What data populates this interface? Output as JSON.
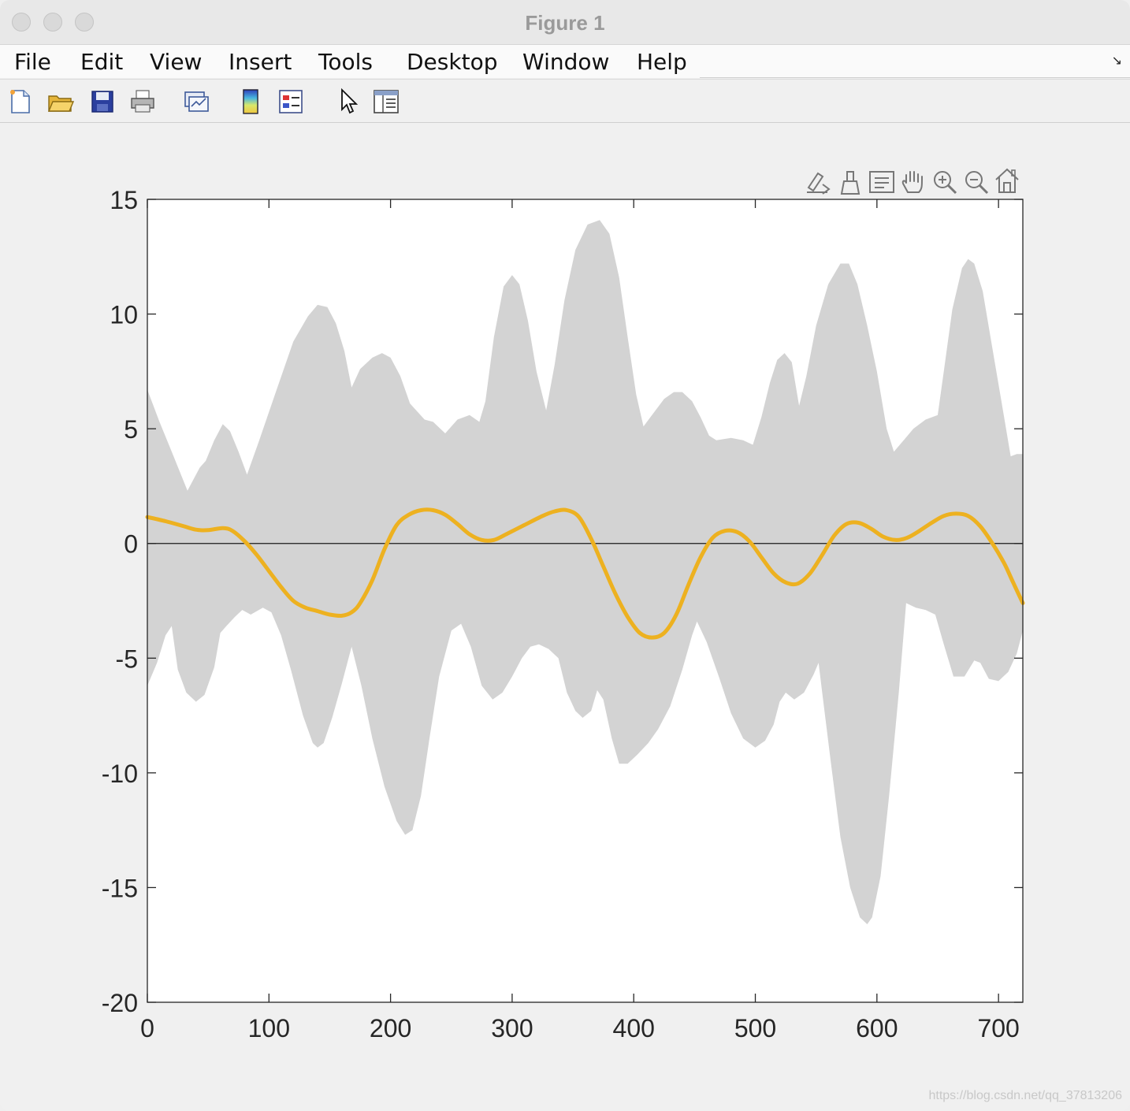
{
  "window": {
    "title": "Figure 1"
  },
  "menu": {
    "items": [
      "File",
      "Edit",
      "View",
      "Insert",
      "Tools",
      "Desktop",
      "Window",
      "Help"
    ]
  },
  "toolbar": {
    "icons": [
      "new-figure-icon",
      "open-file-icon",
      "save-icon",
      "print-icon",
      "link-plot-icon",
      "insert-colorbar-icon",
      "insert-legend-icon",
      "edit-plot-pointer-icon",
      "property-inspector-icon"
    ]
  },
  "axes_toolbar": {
    "icons": [
      "export-icon",
      "brush-icon",
      "data-tips-icon",
      "pan-hand-icon",
      "zoom-in-icon",
      "zoom-out-icon",
      "home-icon"
    ]
  },
  "watermark": "https://blog.csdn.net/qq_37813206",
  "colors": {
    "band": "#d3d3d3",
    "line": "#edb120",
    "zero_line": "#1a1a1a"
  },
  "chart_data": {
    "type": "area",
    "xlim": [
      0,
      720
    ],
    "ylim": [
      -20,
      15
    ],
    "x_ticks": [
      0,
      100,
      200,
      300,
      400,
      500,
      600,
      700
    ],
    "y_ticks": [
      15,
      10,
      5,
      0,
      -5,
      -10,
      -15,
      -20
    ],
    "grid": false,
    "legend": "none",
    "baseline": 0,
    "band_upper": [
      [
        0,
        6.7
      ],
      [
        10,
        5.3
      ],
      [
        20,
        4.0
      ],
      [
        33,
        2.3
      ],
      [
        43,
        3.3
      ],
      [
        48,
        3.6
      ],
      [
        55,
        4.5
      ],
      [
        62,
        5.2
      ],
      [
        68,
        4.9
      ],
      [
        75,
        4.0
      ],
      [
        82,
        3.0
      ],
      [
        92,
        4.5
      ],
      [
        105,
        6.5
      ],
      [
        120,
        8.8
      ],
      [
        132,
        9.9
      ],
      [
        140,
        10.4
      ],
      [
        148,
        10.3
      ],
      [
        155,
        9.6
      ],
      [
        162,
        8.4
      ],
      [
        168,
        6.8
      ],
      [
        175,
        7.6
      ],
      [
        185,
        8.1
      ],
      [
        193,
        8.3
      ],
      [
        200,
        8.1
      ],
      [
        208,
        7.3
      ],
      [
        216,
        6.1
      ],
      [
        228,
        5.4
      ],
      [
        235,
        5.3
      ],
      [
        245,
        4.8
      ],
      [
        255,
        5.4
      ],
      [
        265,
        5.6
      ],
      [
        273,
        5.3
      ],
      [
        278,
        6.2
      ],
      [
        285,
        9.0
      ],
      [
        293,
        11.2
      ],
      [
        300,
        11.7
      ],
      [
        306,
        11.3
      ],
      [
        313,
        9.7
      ],
      [
        320,
        7.5
      ],
      [
        328,
        5.8
      ],
      [
        335,
        7.8
      ],
      [
        343,
        10.6
      ],
      [
        352,
        12.8
      ],
      [
        362,
        13.9
      ],
      [
        372,
        14.1
      ],
      [
        380,
        13.5
      ],
      [
        388,
        11.6
      ],
      [
        395,
        9.0
      ],
      [
        402,
        6.5
      ],
      [
        408,
        5.1
      ],
      [
        415,
        5.6
      ],
      [
        425,
        6.3
      ],
      [
        433,
        6.6
      ],
      [
        440,
        6.6
      ],
      [
        448,
        6.2
      ],
      [
        455,
        5.5
      ],
      [
        462,
        4.7
      ],
      [
        468,
        4.5
      ],
      [
        480,
        4.6
      ],
      [
        490,
        4.5
      ],
      [
        498,
        4.3
      ],
      [
        505,
        5.5
      ],
      [
        512,
        7.0
      ],
      [
        518,
        8.0
      ],
      [
        524,
        8.3
      ],
      [
        530,
        7.9
      ],
      [
        536,
        6.0
      ],
      [
        542,
        7.3
      ],
      [
        550,
        9.5
      ],
      [
        560,
        11.3
      ],
      [
        570,
        12.2
      ],
      [
        577,
        12.2
      ],
      [
        584,
        11.3
      ],
      [
        592,
        9.5
      ],
      [
        600,
        7.5
      ],
      [
        608,
        5.0
      ],
      [
        614,
        4.0
      ],
      [
        622,
        4.5
      ],
      [
        630,
        5.0
      ],
      [
        640,
        5.4
      ],
      [
        650,
        5.6
      ],
      [
        655,
        7.5
      ],
      [
        662,
        10.2
      ],
      [
        670,
        12.0
      ],
      [
        675,
        12.4
      ],
      [
        680,
        12.2
      ],
      [
        687,
        11.0
      ],
      [
        695,
        8.5
      ],
      [
        703,
        6.0
      ],
      [
        710,
        3.8
      ],
      [
        715,
        3.9
      ],
      [
        720,
        3.9
      ]
    ],
    "band_lower": [
      [
        0,
        -6.2
      ],
      [
        8,
        -5.2
      ],
      [
        15,
        -4.0
      ],
      [
        20,
        -3.6
      ],
      [
        25,
        -5.5
      ],
      [
        32,
        -6.5
      ],
      [
        40,
        -6.9
      ],
      [
        47,
        -6.6
      ],
      [
        55,
        -5.4
      ],
      [
        60,
        -3.9
      ],
      [
        65,
        -3.6
      ],
      [
        72,
        -3.2
      ],
      [
        78,
        -2.9
      ],
      [
        85,
        -3.1
      ],
      [
        95,
        -2.8
      ],
      [
        102,
        -3.0
      ],
      [
        110,
        -4.0
      ],
      [
        118,
        -5.5
      ],
      [
        128,
        -7.5
      ],
      [
        136,
        -8.7
      ],
      [
        140,
        -8.9
      ],
      [
        145,
        -8.7
      ],
      [
        152,
        -7.6
      ],
      [
        160,
        -6.1
      ],
      [
        168,
        -4.5
      ],
      [
        176,
        -6.2
      ],
      [
        185,
        -8.5
      ],
      [
        195,
        -10.6
      ],
      [
        205,
        -12.1
      ],
      [
        212,
        -12.7
      ],
      [
        218,
        -12.5
      ],
      [
        225,
        -11.0
      ],
      [
        232,
        -8.5
      ],
      [
        240,
        -5.8
      ],
      [
        250,
        -3.8
      ],
      [
        258,
        -3.5
      ],
      [
        266,
        -4.5
      ],
      [
        275,
        -6.2
      ],
      [
        284,
        -6.8
      ],
      [
        292,
        -6.5
      ],
      [
        300,
        -5.8
      ],
      [
        308,
        -5.0
      ],
      [
        315,
        -4.5
      ],
      [
        322,
        -4.4
      ],
      [
        330,
        -4.6
      ],
      [
        338,
        -5.0
      ],
      [
        345,
        -6.5
      ],
      [
        352,
        -7.3
      ],
      [
        358,
        -7.6
      ],
      [
        365,
        -7.3
      ],
      [
        370,
        -6.4
      ],
      [
        375,
        -6.8
      ],
      [
        382,
        -8.5
      ],
      [
        388,
        -9.6
      ],
      [
        395,
        -9.6
      ],
      [
        403,
        -9.2
      ],
      [
        412,
        -8.7
      ],
      [
        420,
        -8.1
      ],
      [
        430,
        -7.1
      ],
      [
        440,
        -5.5
      ],
      [
        448,
        -4.0
      ],
      [
        452,
        -3.4
      ],
      [
        460,
        -4.3
      ],
      [
        470,
        -5.8
      ],
      [
        480,
        -7.4
      ],
      [
        490,
        -8.5
      ],
      [
        500,
        -8.9
      ],
      [
        508,
        -8.6
      ],
      [
        515,
        -7.9
      ],
      [
        520,
        -6.9
      ],
      [
        525,
        -6.5
      ],
      [
        532,
        -6.8
      ],
      [
        540,
        -6.5
      ],
      [
        548,
        -5.7
      ],
      [
        552,
        -5.2
      ],
      [
        555,
        -6.5
      ],
      [
        562,
        -9.5
      ],
      [
        570,
        -12.8
      ],
      [
        578,
        -15.0
      ],
      [
        586,
        -16.3
      ],
      [
        592,
        -16.6
      ],
      [
        596,
        -16.3
      ],
      [
        603,
        -14.5
      ],
      [
        610,
        -11.0
      ],
      [
        618,
        -6.5
      ],
      [
        624,
        -2.6
      ],
      [
        632,
        -2.8
      ],
      [
        640,
        -2.9
      ],
      [
        648,
        -3.1
      ],
      [
        655,
        -4.4
      ],
      [
        663,
        -5.8
      ],
      [
        672,
        -5.8
      ],
      [
        680,
        -5.1
      ],
      [
        685,
        -5.2
      ],
      [
        692,
        -5.9
      ],
      [
        700,
        -6.0
      ],
      [
        708,
        -5.6
      ],
      [
        715,
        -4.8
      ],
      [
        720,
        -3.8
      ]
    ],
    "series_line": [
      [
        0,
        1.15
      ],
      [
        15,
        0.97
      ],
      [
        30,
        0.75
      ],
      [
        40,
        0.6
      ],
      [
        50,
        0.58
      ],
      [
        62,
        0.67
      ],
      [
        70,
        0.55
      ],
      [
        80,
        0.1
      ],
      [
        90,
        -0.5
      ],
      [
        100,
        -1.2
      ],
      [
        110,
        -1.9
      ],
      [
        120,
        -2.5
      ],
      [
        130,
        -2.8
      ],
      [
        140,
        -2.95
      ],
      [
        150,
        -3.1
      ],
      [
        160,
        -3.15
      ],
      [
        168,
        -3.0
      ],
      [
        175,
        -2.6
      ],
      [
        185,
        -1.6
      ],
      [
        195,
        -0.25
      ],
      [
        205,
        0.8
      ],
      [
        215,
        1.25
      ],
      [
        225,
        1.45
      ],
      [
        235,
        1.45
      ],
      [
        245,
        1.25
      ],
      [
        255,
        0.85
      ],
      [
        265,
        0.4
      ],
      [
        275,
        0.15
      ],
      [
        285,
        0.15
      ],
      [
        295,
        0.4
      ],
      [
        310,
        0.8
      ],
      [
        325,
        1.2
      ],
      [
        335,
        1.4
      ],
      [
        345,
        1.45
      ],
      [
        355,
        1.15
      ],
      [
        365,
        0.2
      ],
      [
        375,
        -1.0
      ],
      [
        385,
        -2.2
      ],
      [
        395,
        -3.2
      ],
      [
        405,
        -3.9
      ],
      [
        415,
        -4.1
      ],
      [
        425,
        -3.9
      ],
      [
        435,
        -3.1
      ],
      [
        445,
        -1.8
      ],
      [
        455,
        -0.6
      ],
      [
        465,
        0.25
      ],
      [
        475,
        0.55
      ],
      [
        485,
        0.5
      ],
      [
        495,
        0.1
      ],
      [
        505,
        -0.6
      ],
      [
        515,
        -1.3
      ],
      [
        525,
        -1.7
      ],
      [
        535,
        -1.75
      ],
      [
        545,
        -1.3
      ],
      [
        555,
        -0.5
      ],
      [
        565,
        0.35
      ],
      [
        575,
        0.85
      ],
      [
        585,
        0.9
      ],
      [
        595,
        0.65
      ],
      [
        605,
        0.3
      ],
      [
        615,
        0.15
      ],
      [
        625,
        0.25
      ],
      [
        635,
        0.55
      ],
      [
        645,
        0.9
      ],
      [
        655,
        1.2
      ],
      [
        665,
        1.3
      ],
      [
        675,
        1.2
      ],
      [
        685,
        0.75
      ],
      [
        695,
        0.0
      ],
      [
        705,
        -0.9
      ],
      [
        712,
        -1.7
      ],
      [
        720,
        -2.6
      ]
    ]
  }
}
